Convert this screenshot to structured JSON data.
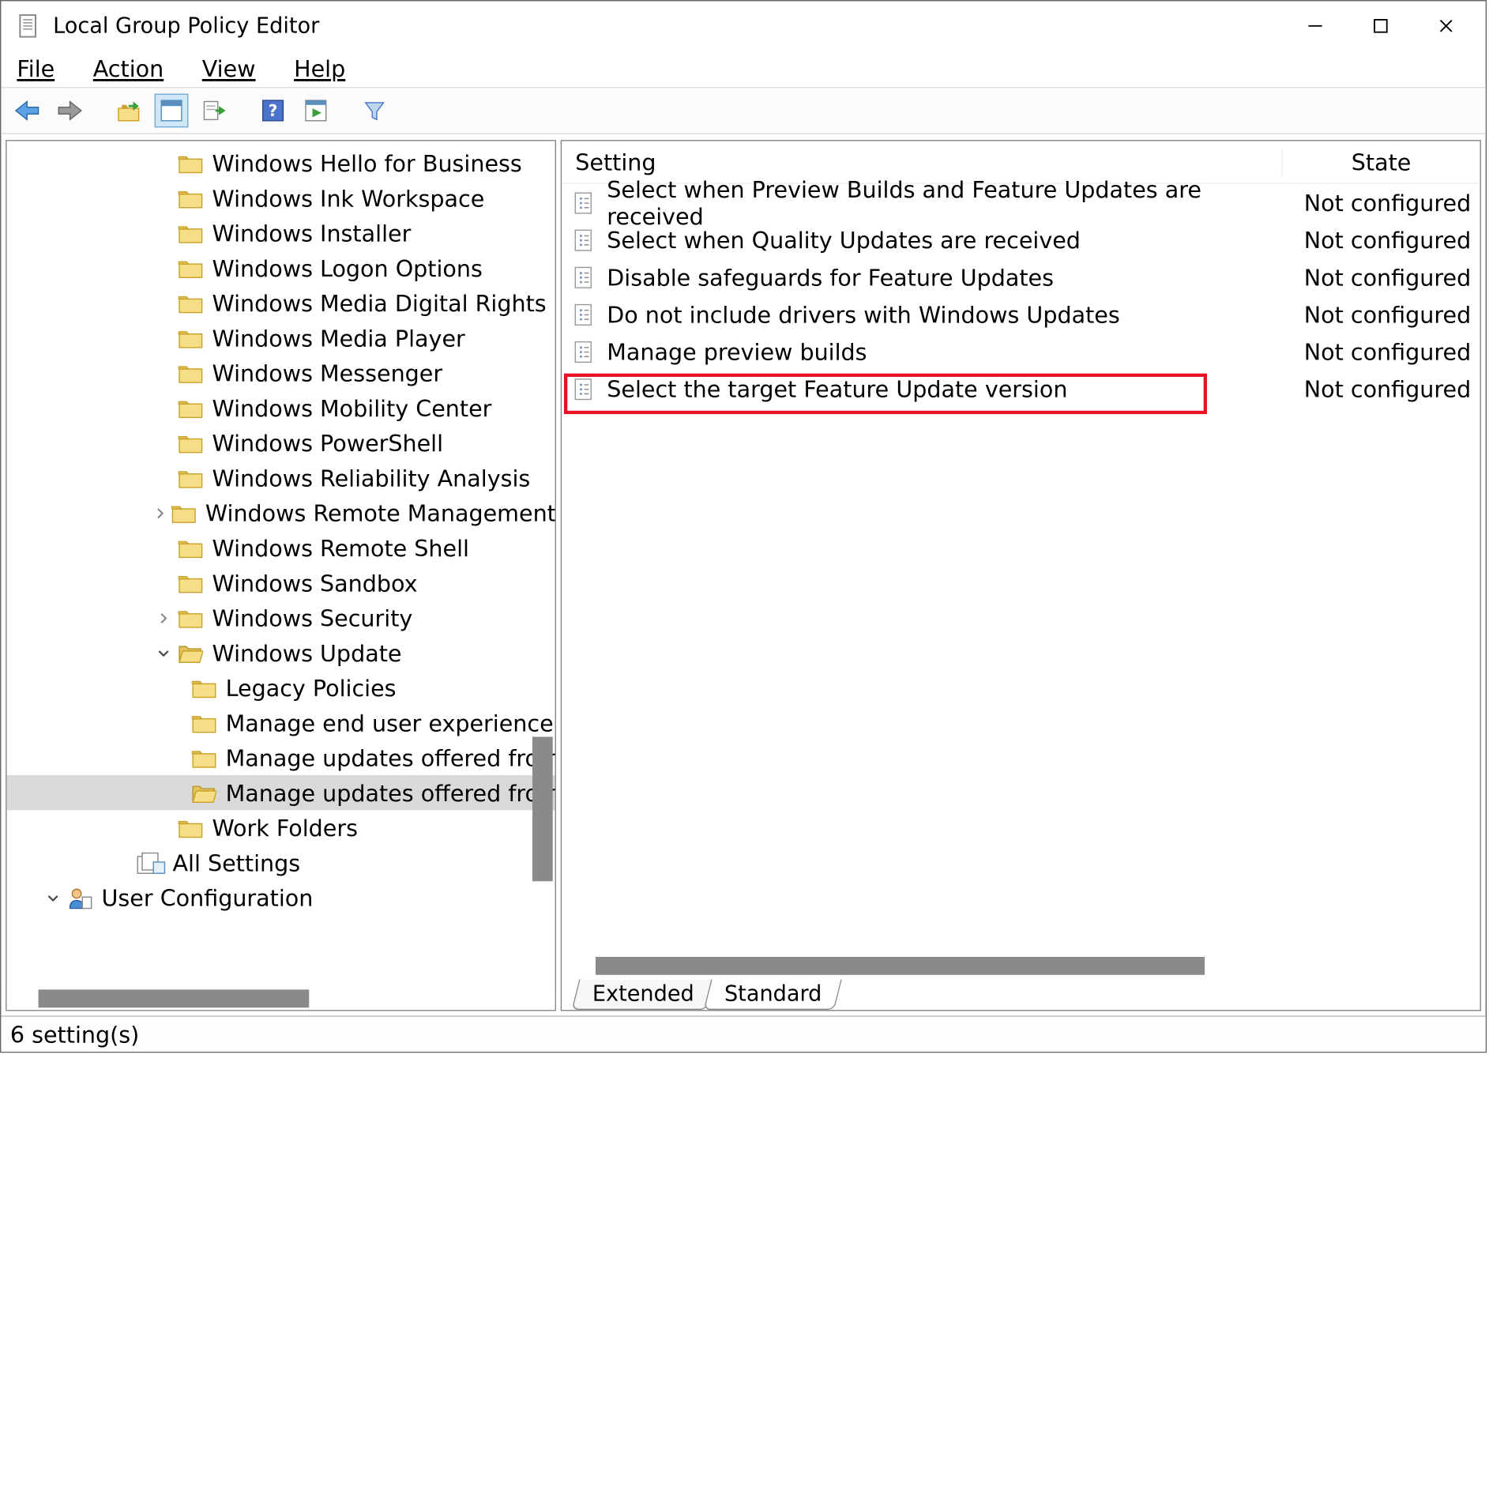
{
  "window": {
    "title": "Local Group Policy Editor"
  },
  "menubar": {
    "file": "File",
    "action": "Action",
    "view": "View",
    "help": "Help"
  },
  "tree": {
    "items": [
      {
        "label": "Windows Hello for Business",
        "indent": 1
      },
      {
        "label": "Windows Ink Workspace",
        "indent": 1
      },
      {
        "label": "Windows Installer",
        "indent": 1
      },
      {
        "label": "Windows Logon Options",
        "indent": 1
      },
      {
        "label": "Windows Media Digital Rights",
        "indent": 1
      },
      {
        "label": "Windows Media Player",
        "indent": 1
      },
      {
        "label": "Windows Messenger",
        "indent": 1
      },
      {
        "label": "Windows Mobility Center",
        "indent": 1
      },
      {
        "label": "Windows PowerShell",
        "indent": 1
      },
      {
        "label": "Windows Reliability Analysis",
        "indent": 1
      },
      {
        "label": "Windows Remote Management",
        "indent": 1,
        "expander": "collapsed"
      },
      {
        "label": "Windows Remote Shell",
        "indent": 1
      },
      {
        "label": "Windows Sandbox",
        "indent": 1
      },
      {
        "label": "Windows Security",
        "indent": 1,
        "expander": "collapsed"
      },
      {
        "label": "Windows Update",
        "indent": 1,
        "expander": "expanded",
        "open": true
      },
      {
        "label": "Legacy Policies",
        "indent": 2
      },
      {
        "label": "Manage end user experience",
        "indent": 2
      },
      {
        "label": "Manage updates offered from",
        "indent": 2
      },
      {
        "label": "Manage updates offered from",
        "indent": 2,
        "selected": true,
        "open": true
      },
      {
        "label": "Work Folders",
        "indent": 1
      }
    ],
    "all_settings": "All Settings",
    "user_config": "User Configuration"
  },
  "list": {
    "col_setting": "Setting",
    "col_state": "State",
    "rows": [
      {
        "setting": "Select when Preview Builds and Feature Updates are received",
        "state": "Not configured"
      },
      {
        "setting": "Select when Quality Updates are received",
        "state": "Not configured"
      },
      {
        "setting": "Disable safeguards for Feature Updates",
        "state": "Not configured"
      },
      {
        "setting": "Do not include drivers with Windows Updates",
        "state": "Not configured"
      },
      {
        "setting": "Manage preview builds",
        "state": "Not configured"
      },
      {
        "setting": "Select the target Feature Update version",
        "state": "Not configured",
        "highlighted": true
      }
    ]
  },
  "tabs": {
    "extended": "Extended",
    "standard": "Standard"
  },
  "status": {
    "text": "6 setting(s)"
  }
}
